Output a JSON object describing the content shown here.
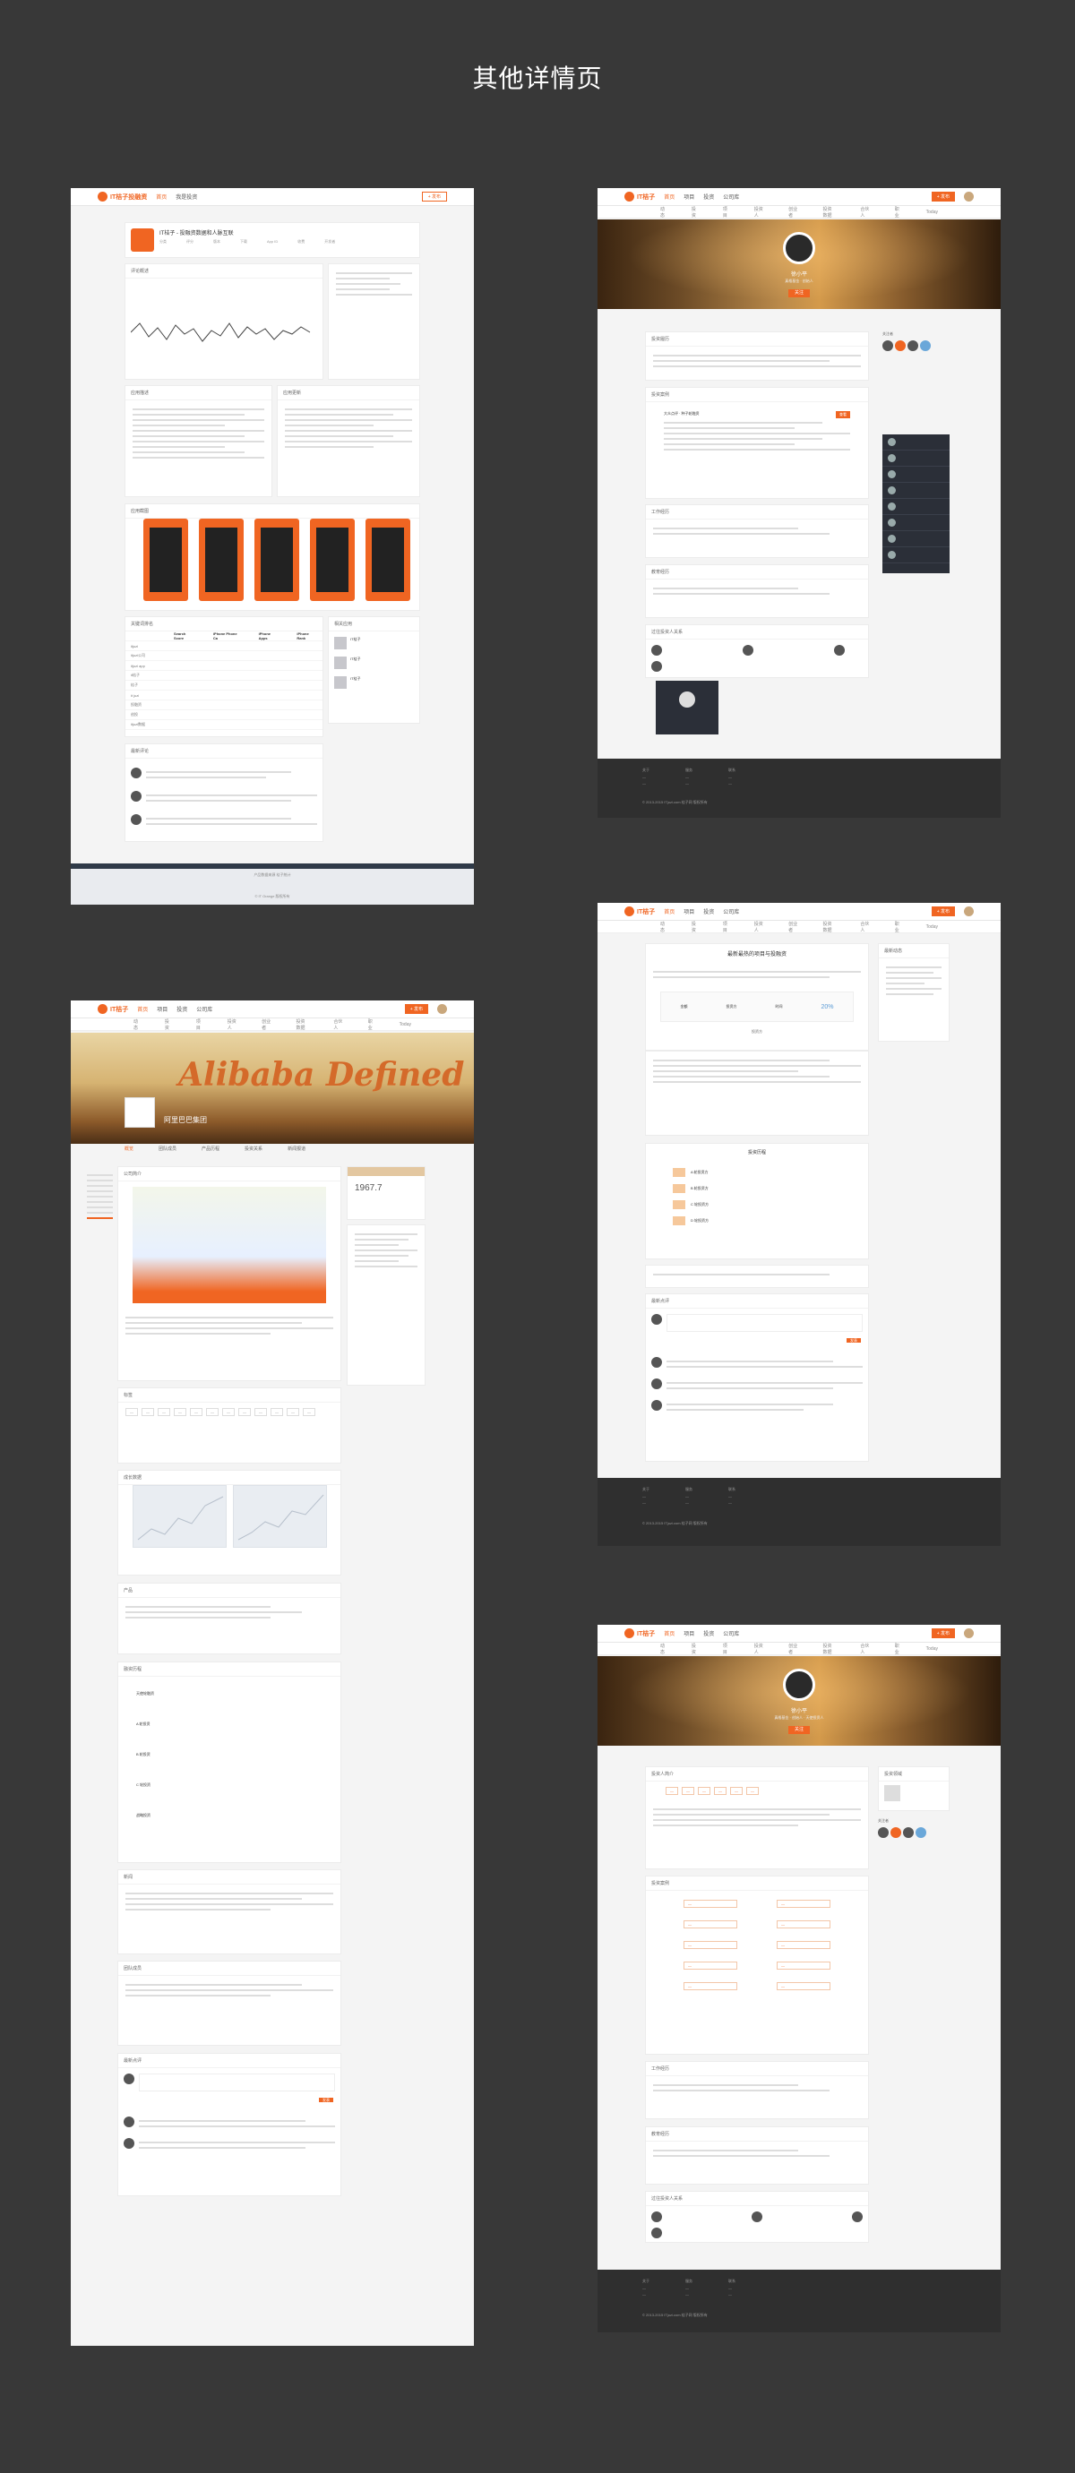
{
  "page_title": "其他详情页",
  "colors": {
    "accent": "#f06522",
    "background": "#383838"
  },
  "nav": {
    "logo": "IT桔子",
    "items": [
      "首页",
      "项目",
      "投资",
      "公司库"
    ],
    "publish_button": "+ 发布"
  },
  "panel1": {
    "logo": "IT桔子投融资",
    "tabs": [
      "首页",
      "我是投资"
    ],
    "app_title": "IT桔子 - 投融资数据和人脉互联",
    "stats": [
      "分类",
      "评分",
      "版本",
      "下载",
      "App ID",
      "收费",
      "开发者"
    ],
    "sections": [
      "评论概述",
      "应用描述",
      "应用更新",
      "应用截图",
      "关键词排名",
      "相关应用",
      "最新评论"
    ],
    "keyword_headers": [
      "",
      "Search Score",
      "iPhone Phone Ca",
      "iPhone Apps",
      "iPhone Rank"
    ],
    "keywords": [
      "itjuzi",
      "itjuzi公司",
      "itjuzi app",
      "it桔子",
      "桔子",
      "it juzi",
      "投融资",
      "创投",
      "itjuzi数据"
    ],
    "related": [
      "IT桔子",
      "IT桔子",
      "IT桔子"
    ],
    "footer": [
      "产品数据来源 桔子统计",
      "© IT Orange 版权所有"
    ]
  },
  "panel2": {
    "user_name": "徐小平",
    "user_title": "真格基金 · 创始人",
    "follow_button": "关注",
    "tabs": [
      "动态",
      "投资",
      "项目",
      "投资人",
      "创业者",
      "投资数据",
      "合伙人",
      "职业",
      "Today"
    ],
    "sections": [
      "投资履历",
      "投资案例",
      "工作经历",
      "教育经历",
      "过往投资人关系"
    ],
    "side_title": "关注者",
    "investment_item": "大众点评 · 种子轮融资",
    "invest_button": "查看"
  },
  "panel3": {
    "title": "最新最热的项目与投融资",
    "sections": [
      "最新点评",
      "投资方",
      "投资历程",
      "最新动态"
    ],
    "rounds": [
      "A 轮投资方",
      "B 轮投资方",
      "C 轮投资方",
      "D 轮投资方"
    ],
    "amount_labels": [
      "金额",
      "投资方",
      "时间"
    ],
    "share": "20%",
    "comment_button": "发表"
  },
  "panel4": {
    "company_name": "阿里巴巴集团",
    "banner_text": "Alibaba Defined",
    "tabs": [
      "概览",
      "团队成员",
      "产品历程",
      "投资关系",
      "新闻报道"
    ],
    "score": "1967.7",
    "sections": [
      "公司简介",
      "标签",
      "成长数据",
      "产品",
      "融资历程",
      "新闻",
      "团队成员",
      "最新点评"
    ],
    "events": [
      "天使轮融资",
      "A 轮投资",
      "B 轮投资",
      "C 轮投资",
      "战略投资"
    ],
    "comment_button": "发表"
  },
  "panel5": {
    "user_name": "徐小平",
    "user_title": "真格基金 · 创始人 · 天使投资人",
    "follow_button": "关注",
    "sections": [
      "投资人简介",
      "投资案例",
      "工作经历",
      "教育经历",
      "过往投资人关系"
    ],
    "side": [
      "投资领域",
      "关注者"
    ]
  },
  "footer": {
    "columns": [
      "关于",
      "服务",
      "联系"
    ],
    "copyright": "© 2013-2015 ITjuzi.com 桔子网 版权所有"
  }
}
